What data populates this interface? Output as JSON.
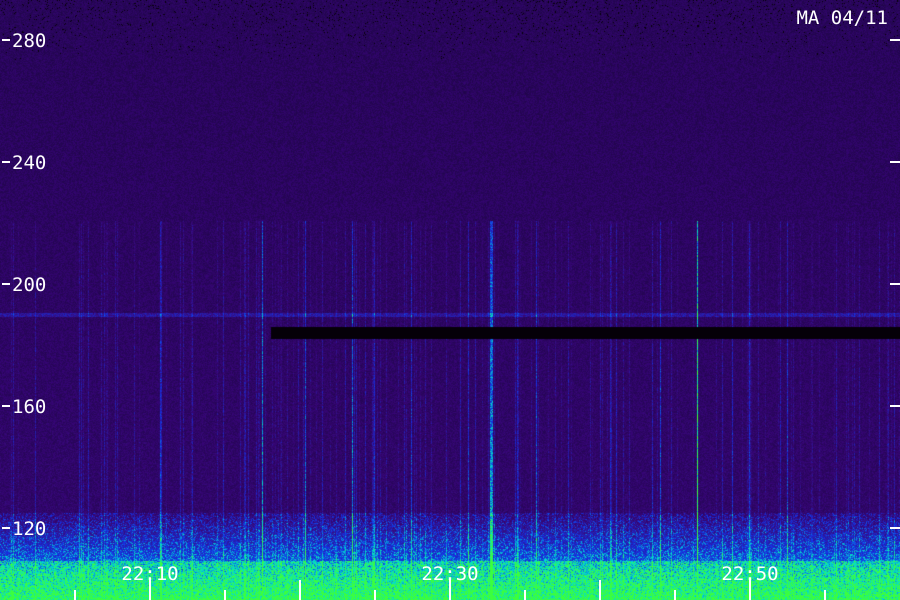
{
  "chart_data": {
    "type": "heatmap",
    "title": "MA 04/11",
    "y_ticks": [
      280,
      240,
      200,
      160,
      120
    ],
    "ylim": [
      100,
      290
    ],
    "x_ticks": [
      "22:10",
      "22:30",
      "22:50"
    ],
    "colors": {
      "background": "#3a0a6e",
      "dark_band": "#050008",
      "low": "#2a0a5a",
      "mid": "#1a30d0",
      "high": "#00e0d0",
      "peak": "#40ff40"
    },
    "features": {
      "dark_band_value": 184,
      "bright_band_value": 190,
      "noise_floor_top_value": 125
    }
  }
}
